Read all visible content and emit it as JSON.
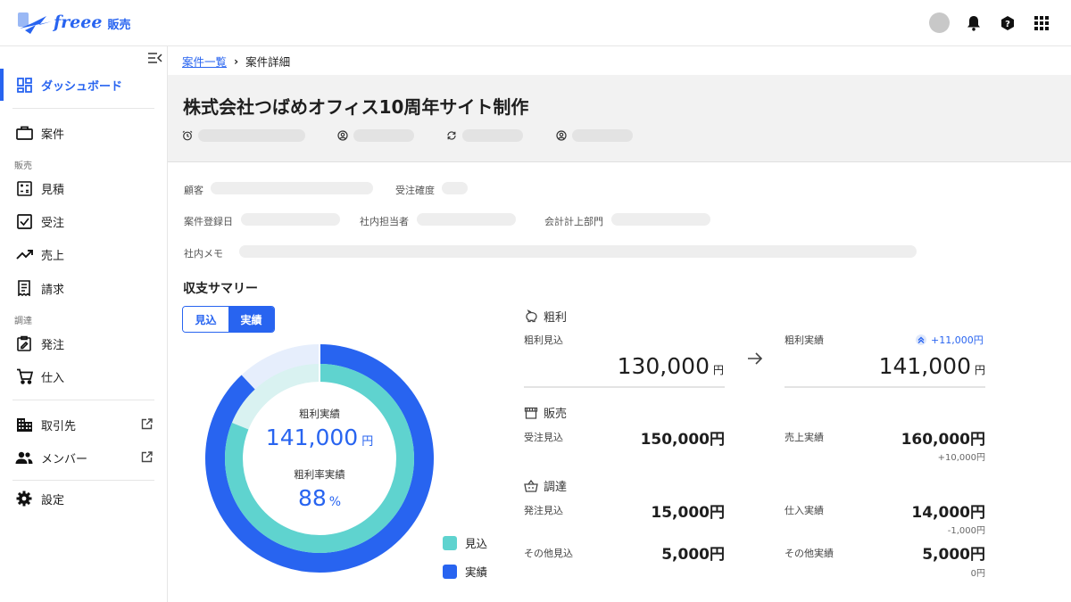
{
  "header": {
    "logo_text": "freee",
    "logo_sub": "販売",
    "icons": [
      "avatar",
      "bell-icon",
      "help-icon",
      "apps-grid-icon"
    ]
  },
  "sidebar": {
    "items": [
      {
        "label": "ダッシュボード",
        "icon": "dashboard-icon",
        "active": true
      },
      {
        "label": "案件",
        "icon": "briefcase-icon"
      },
      {
        "label": "見積",
        "icon": "calculator-icon"
      },
      {
        "label": "受注",
        "icon": "checkbox-icon"
      },
      {
        "label": "売上",
        "icon": "trending-up-icon"
      },
      {
        "label": "請求",
        "icon": "receipt-icon"
      },
      {
        "label": "発注",
        "icon": "clipboard-edit-icon"
      },
      {
        "label": "仕入",
        "icon": "cart-icon"
      },
      {
        "label": "取引先",
        "icon": "building-icon",
        "external": true
      },
      {
        "label": "メンバー",
        "icon": "people-icon",
        "external": true
      },
      {
        "label": "設定",
        "icon": "gear-icon"
      }
    ],
    "sections": {
      "sales": "販売",
      "procurement": "調達"
    }
  },
  "breadcrumb": {
    "parent": "案件一覧",
    "current": "案件詳細"
  },
  "page_title": "株式会社つばめオフィス10周年サイト制作",
  "info": {
    "customer_label": "顧客",
    "certainty_label": "受注確度",
    "registered_label": "案件登録日",
    "assignee_label": "社内担当者",
    "department_label": "会計計上部門",
    "memo_label": "社内メモ"
  },
  "summary": {
    "title": "収支サマリー",
    "toggle": {
      "forecast": "見込",
      "actual": "実績",
      "selected": "actual"
    },
    "donut": {
      "label1": "粗利実績",
      "value1": "141,000",
      "unit1": "円",
      "label2": "粗利率実績",
      "value2": "88",
      "unit2": "%"
    },
    "legend": {
      "forecast": "見込",
      "actual": "実績"
    },
    "colors": {
      "forecast": "#5fd3cf",
      "actual": "#2864f0",
      "forecast_light": "#d9f2f1",
      "actual_light": "#e6eefc"
    },
    "gross": {
      "head": "粗利",
      "forecast_label": "粗利見込",
      "forecast_value": "130,000",
      "actual_label": "粗利実績",
      "actual_value": "141,000",
      "unit": "円",
      "diff": "+11,000円"
    },
    "sales": {
      "head": "販売",
      "forecast_label": "受注見込",
      "forecast_value": "150,000円",
      "actual_label": "売上実績",
      "actual_value": "160,000円",
      "actual_diff": "+10,000円"
    },
    "procure": {
      "head": "調達",
      "forecast_label": "発注見込",
      "forecast_value": "15,000円",
      "actual_label": "仕入実績",
      "actual_value": "14,000円",
      "actual_diff": "-1,000円",
      "other_forecast_label": "その他見込",
      "other_forecast_value": "5,000円",
      "other_actual_label": "その他実績",
      "other_actual_value": "5,000円",
      "other_actual_diff": "0円"
    }
  }
}
